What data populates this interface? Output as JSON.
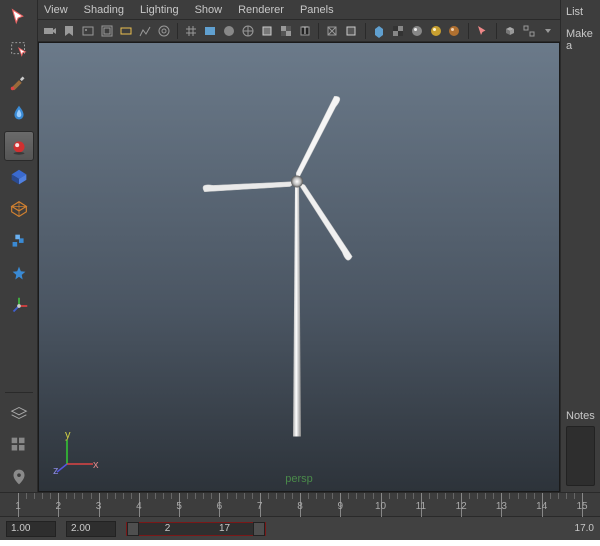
{
  "panel_menu": [
    "View",
    "Shading",
    "Lighting",
    "Show",
    "Renderer",
    "Panels"
  ],
  "right_panel": {
    "list_label": "List",
    "make_label": "Make a",
    "notes_label": "Notes"
  },
  "viewport": {
    "camera": "persp",
    "axes": {
      "x": "x",
      "y": "y",
      "z": "z"
    }
  },
  "timeline": {
    "start": 1,
    "end": 15,
    "labels": [
      "1",
      "2",
      "3",
      "4",
      "5",
      "6",
      "7",
      "8",
      "9",
      "10",
      "11",
      "12",
      "13",
      "14",
      "15"
    ]
  },
  "range": {
    "anim_start": "1.00",
    "anim_end": "2.00",
    "range_start": "2",
    "range_end": "17",
    "playback_end": "17.0"
  },
  "tools": [
    "select",
    "lasso",
    "paint",
    "sculpt",
    "move",
    "rotate",
    "scale",
    "transform",
    "snap",
    "manip"
  ],
  "bottom_tools": [
    "layer",
    "grid",
    "outliner"
  ],
  "icon_colors": {
    "select_arrow": "#e66",
    "lasso": "#e66",
    "paint": "#d44",
    "sculpt_flame": "#3a8ad4",
    "wire_cube": "#d08030",
    "ball_red": "#d03030",
    "ball_blue": "#3a6ad0",
    "snap": "#3a8ad4",
    "manip_r": "#d04040",
    "manip_g": "#40b040",
    "manip_b": "#4060d0",
    "sphere": "#888",
    "gold": "#c8a030",
    "bronze": "#b07030"
  }
}
